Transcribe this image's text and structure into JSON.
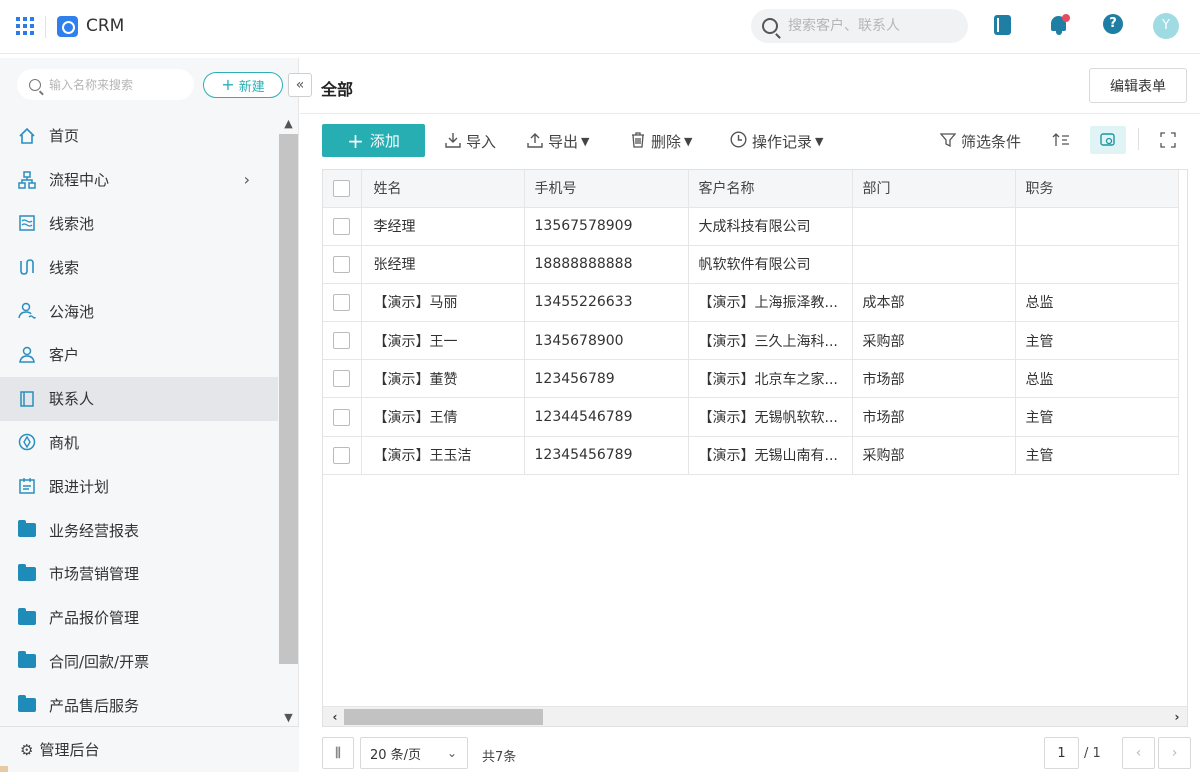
{
  "header": {
    "app_name": "CRM",
    "search_placeholder": "搜索客户、联系人",
    "avatar_letter": "Y"
  },
  "sidebar": {
    "search_placeholder": "输入名称来搜索",
    "new_button_label": "新建",
    "items": [
      {
        "label": "首页",
        "icon": "home-icon"
      },
      {
        "label": "流程中心",
        "icon": "flow-icon"
      },
      {
        "label": "线索池",
        "icon": "pool-icon"
      },
      {
        "label": "线索",
        "icon": "lead-icon"
      },
      {
        "label": "公海池",
        "icon": "public-pool-icon"
      },
      {
        "label": "客户",
        "icon": "customer-icon"
      },
      {
        "label": "联系人",
        "icon": "contact-icon"
      },
      {
        "label": "商机",
        "icon": "opportunity-icon"
      },
      {
        "label": "跟进计划",
        "icon": "plan-icon"
      },
      {
        "label": "业务经营报表",
        "icon": "folder-icon"
      },
      {
        "label": "市场营销管理",
        "icon": "folder-icon"
      },
      {
        "label": "产品报价管理",
        "icon": "folder-icon"
      },
      {
        "label": "合同/回款/开票",
        "icon": "folder-icon"
      },
      {
        "label": "产品售后服务",
        "icon": "folder-icon"
      }
    ],
    "footer_label": "管理后台"
  },
  "main": {
    "title": "全部",
    "edit_form_label": "编辑表单",
    "toolbar": {
      "add_label": "添加",
      "import_label": "导入",
      "export_label": "导出",
      "delete_label": "删除",
      "log_label": "操作记录",
      "filter_label": "筛选条件"
    },
    "table": {
      "columns": [
        "姓名",
        "手机号",
        "客户名称",
        "部门",
        "职务"
      ],
      "rows": [
        [
          "李经理",
          "13567578909",
          "大成科技有限公司",
          "",
          ""
        ],
        [
          "张经理",
          "18888888888",
          "帆软软件有限公司",
          "",
          ""
        ],
        [
          "【演示】马丽",
          "13455226633",
          "【演示】上海振泽教...",
          "成本部",
          "总监"
        ],
        [
          "【演示】王一",
          "1345678900",
          "【演示】三久上海科...",
          "采购部",
          "主管"
        ],
        [
          "【演示】董赞",
          "123456789",
          "【演示】北京车之家...",
          "市场部",
          "总监"
        ],
        [
          "【演示】王倩",
          "12344546789",
          "【演示】无锡帆软软...",
          "市场部",
          "主管"
        ],
        [
          "【演示】王玉洁",
          "12345456789",
          "【演示】无锡山南有...",
          "采购部",
          "主管"
        ]
      ]
    },
    "pager": {
      "page_size_label": "20 条/页",
      "total_label": "共7条",
      "current_page": "1",
      "page_count_label": "/ 1"
    }
  }
}
